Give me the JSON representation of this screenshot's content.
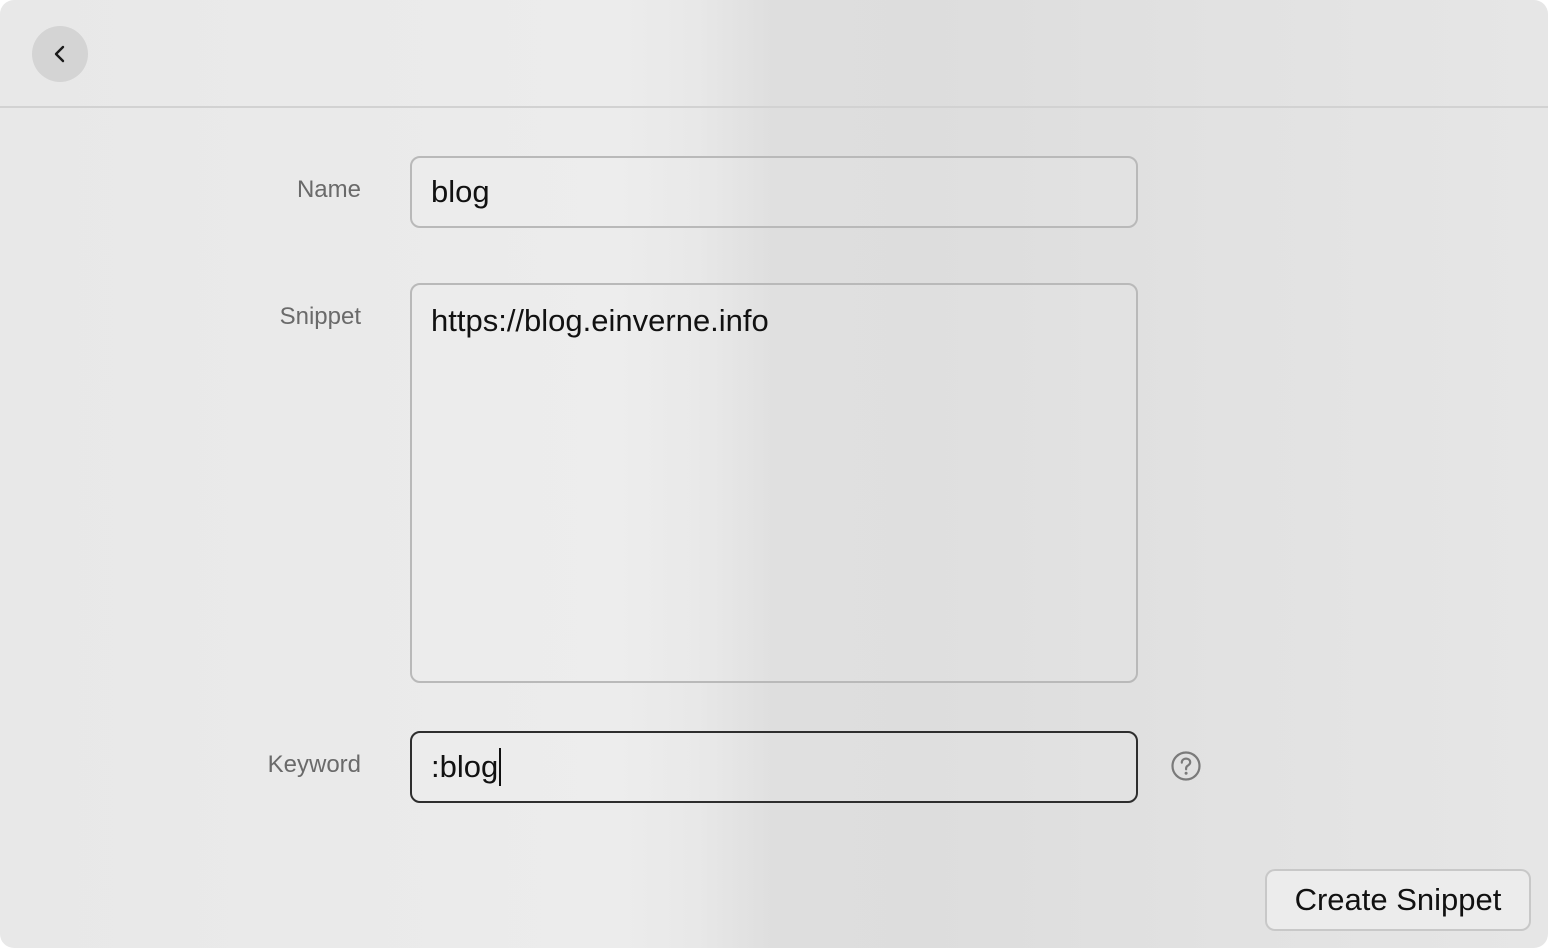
{
  "header": {
    "back_icon": "chevron-left-icon"
  },
  "form": {
    "name": {
      "label": "Name",
      "value": "blog"
    },
    "snippet": {
      "label": "Snippet",
      "value": "https://blog.einverne.info"
    },
    "keyword": {
      "label": "Keyword",
      "value": ":blog",
      "help_icon": "question-circle-icon"
    }
  },
  "actions": {
    "create_label": "Create Snippet"
  }
}
